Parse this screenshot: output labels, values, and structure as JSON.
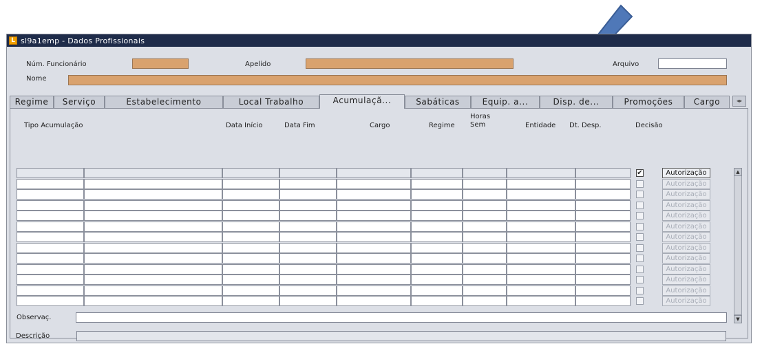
{
  "window": {
    "title": "sl9a1emp - Dados Profissionais",
    "app_icon": "app-icon"
  },
  "header": {
    "num_funcionario_label": "Núm. Funcionário",
    "num_funcionario_value": "",
    "apelido_label": "Apelido",
    "apelido_value": "",
    "arquivo_label": "Arquivo",
    "arquivo_value": "",
    "nome_label": "Nome",
    "nome_value": ""
  },
  "tabs": [
    {
      "label": "Regime",
      "active": false
    },
    {
      "label": "Serviço",
      "active": false
    },
    {
      "label": "Estabelecimento",
      "active": false
    },
    {
      "label": "Local Trabalho",
      "active": false
    },
    {
      "label": "Acumulaçã...",
      "active": true
    },
    {
      "label": "Sabáticas",
      "active": false
    },
    {
      "label": "Equip. a...",
      "active": false
    },
    {
      "label": "Disp. de...",
      "active": false
    },
    {
      "label": "Promoções",
      "active": false
    },
    {
      "label": "Cargo",
      "active": false
    }
  ],
  "tab_scroll": "◂▸",
  "grid": {
    "columns": {
      "tipo": "Tipo Acumulação",
      "data_inicio": "Data Início",
      "data_fim": "Data Fim",
      "cargo": "Cargo",
      "regime": "Regime",
      "horas_sem_1": "Horas",
      "horas_sem_2": "Sem",
      "entidade": "Entidade",
      "dt_desp": "Dt. Desp.",
      "decisao": "Decisão"
    },
    "row_count": 13,
    "first_row_checked": true,
    "button_label": "Autorização",
    "check_mark": "✔",
    "scroll_up": "▲",
    "scroll_down": "▼"
  },
  "footer": {
    "descricao_label": "Descrição",
    "descricao_value": "",
    "observacao_label": "Observaç.",
    "observacao_value": ""
  },
  "colors": {
    "titlebar": "#1f2c4a",
    "required_field": "#d9a26e",
    "annotation_arrow": "#4f78b8"
  },
  "annotation": {
    "icon": "pointer-arrow-icon"
  }
}
